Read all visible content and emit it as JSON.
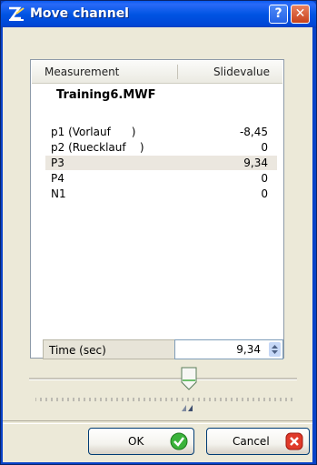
{
  "window": {
    "title": "Move channel"
  },
  "titlebar": {
    "help_label": "?",
    "close_label": "✕"
  },
  "list": {
    "header_measurement": "Measurement",
    "header_slidevalue": "Slidevalue",
    "file_name": "Training6.MWF",
    "rows": [
      {
        "name": "p1 (Vorlauf      )",
        "value": "-8,45"
      },
      {
        "name": "p2 (Ruecklauf    )",
        "value": "0"
      },
      {
        "name": "P3",
        "value": "9,34",
        "selected": true
      },
      {
        "name": "P4",
        "value": "0"
      },
      {
        "name": "N1",
        "value": "0"
      }
    ]
  },
  "time": {
    "label": "Time (sec)",
    "value": "9,34"
  },
  "buttons": {
    "ok_label": "OK",
    "cancel_label": "Cancel"
  },
  "icons": {
    "app": "app-logo-icon",
    "ok": "checkmark-icon",
    "cancel": "cancel-x-icon",
    "spin": "spinner-arrows-icon",
    "slider": "slider-thumb-icon",
    "marker": "position-marker-icon"
  },
  "colors": {
    "titlebar": "#0054e3",
    "client_bg": "#ece9d8",
    "selected_row": "#ebe7df",
    "ok_green": "#3bb33b",
    "cancel_red": "#e03a2a"
  }
}
